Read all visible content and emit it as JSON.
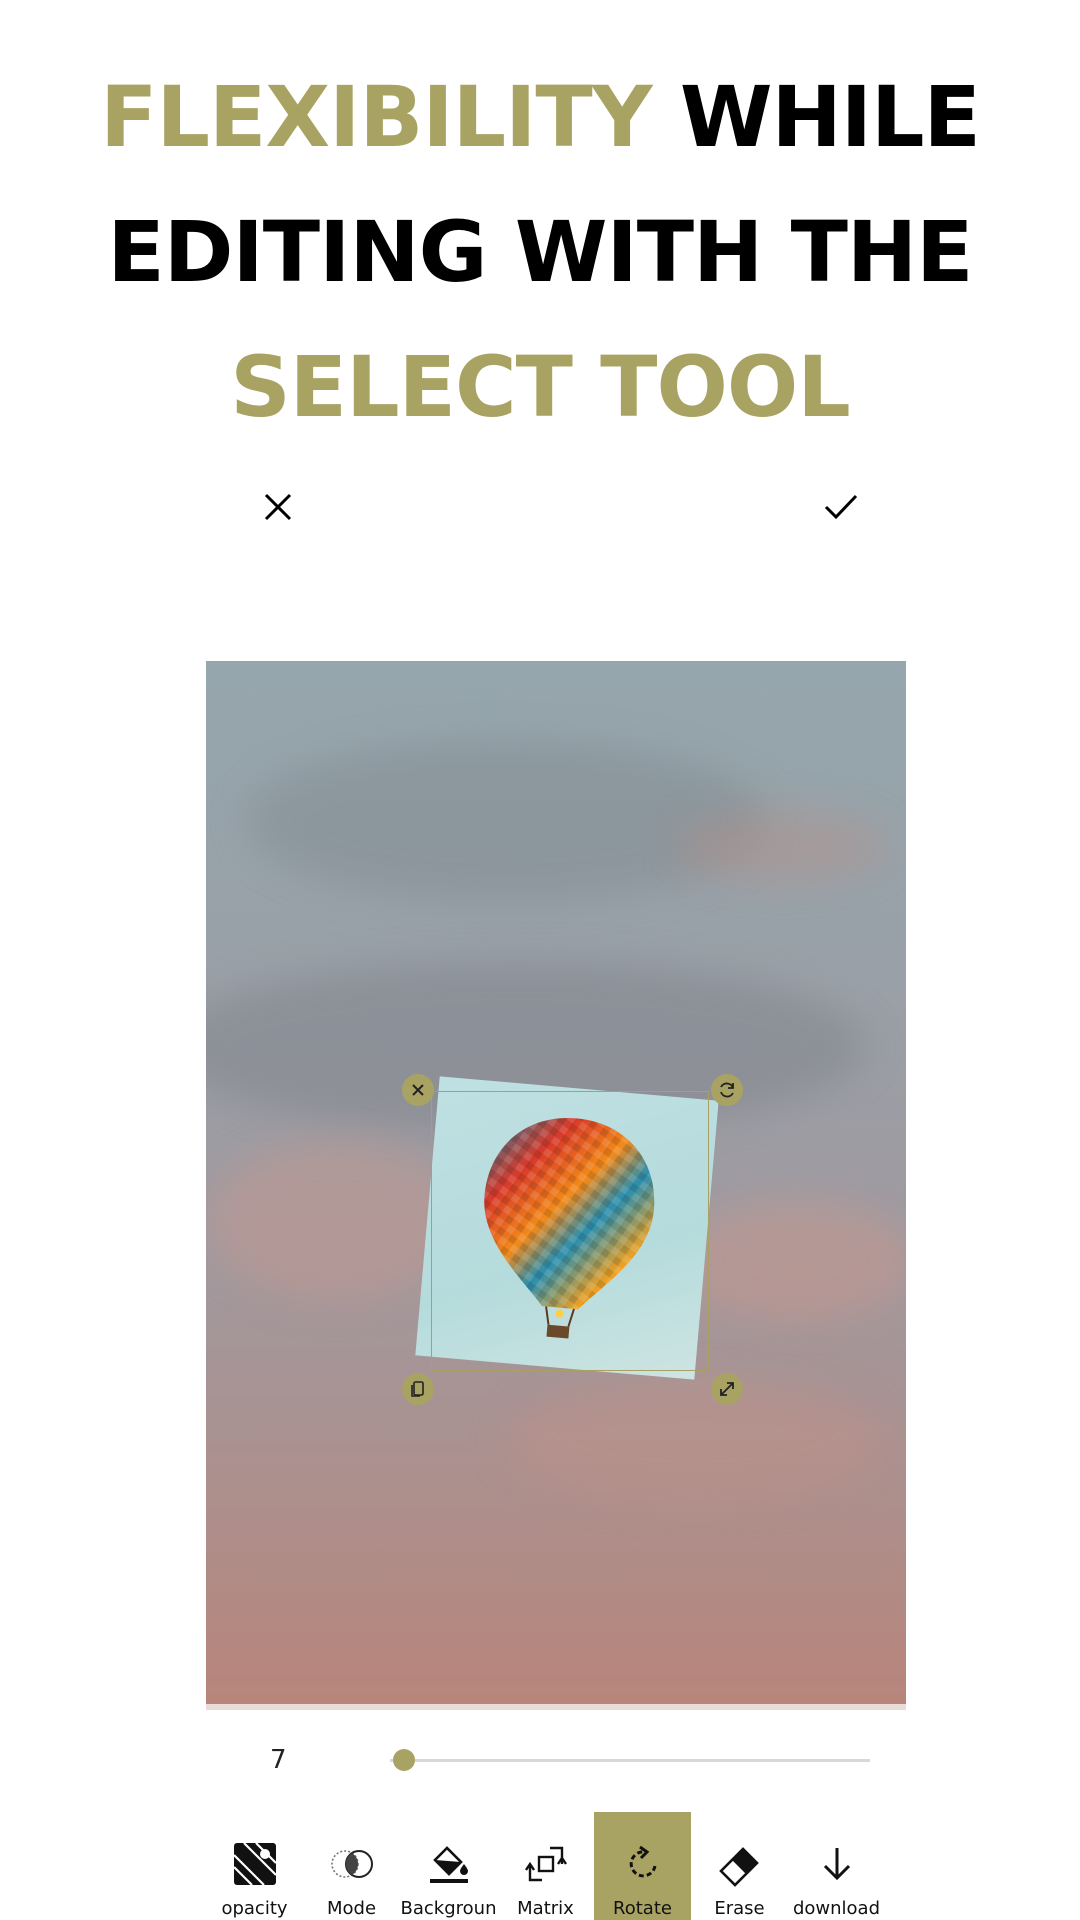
{
  "theme": {
    "accent": "#a9a363",
    "text": "#000000"
  },
  "headline": {
    "line1_accent": "FLEXIBILITY",
    "line1_rest": "WHILE",
    "line2": "EDITING WITH THE",
    "line3_accent": "SELECT TOOL"
  },
  "topbar": {
    "cancel_icon": "close-icon",
    "confirm_icon": "check-icon"
  },
  "selection": {
    "handles": [
      "close-icon",
      "rotate-icon",
      "flip-icon",
      "resize-icon"
    ]
  },
  "slider": {
    "value": "7",
    "level": 0.03
  },
  "toolbar": {
    "active": "rotate",
    "items": [
      {
        "id": "opacity",
        "label": "opacity",
        "icon": "opacity-icon"
      },
      {
        "id": "mode",
        "label": "Mode",
        "icon": "blend-mode-icon"
      },
      {
        "id": "background",
        "label": "Backgroun",
        "icon": "paint-bucket-icon"
      },
      {
        "id": "matrix",
        "label": "Matrix",
        "icon": "matrix-icon"
      },
      {
        "id": "rotate",
        "label": "Rotate",
        "icon": "rotate-icon"
      },
      {
        "id": "erase",
        "label": "Erase",
        "icon": "eraser-icon"
      },
      {
        "id": "download",
        "label": "download",
        "icon": "download-icon"
      }
    ]
  }
}
